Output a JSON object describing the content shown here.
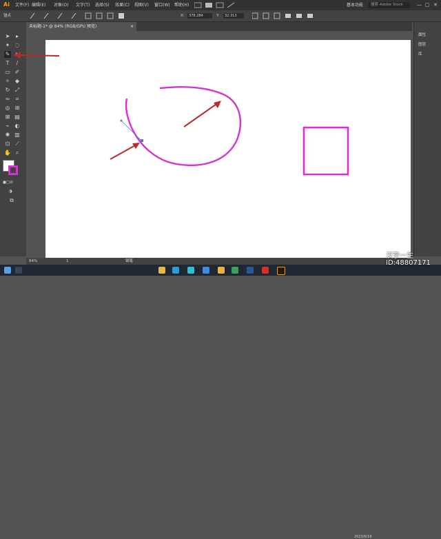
{
  "app": {
    "logo": "Ai",
    "accent": "#ff9a00"
  },
  "menubar": {
    "items": [
      "文件(F)",
      "编辑(E)",
      "对象(O)",
      "文字(T)",
      "选择(S)",
      "效果(C)",
      "视图(V)",
      "窗口(W)",
      "帮助(H)"
    ],
    "workspace": "基本功能",
    "search_placeholder": "搜索 Adobe Stock",
    "minimize": "—",
    "maximize": "▢",
    "close": "✕"
  },
  "controlbar": {
    "left_label": "锚点",
    "x_value": "378.284",
    "y_value": "32.313",
    "reference_icon": "reference-point-icon"
  },
  "document": {
    "tab_label": "未标题-1* @ 84% (RGB/GPU 预览)",
    "close": "×"
  },
  "right_panel": {
    "items": [
      "属性",
      "图层",
      "库"
    ]
  },
  "status": {
    "zoom": "84%",
    "page": "1",
    "mode": "钢笔"
  },
  "colors": {
    "stroke": "#d531d5",
    "arrow": "#c0282a",
    "canvas": "#ffffff"
  },
  "watermark": {
    "line1": "汉字一生",
    "line2": "ID:48807171"
  },
  "taskbar": {
    "date": "2023/6/16"
  }
}
